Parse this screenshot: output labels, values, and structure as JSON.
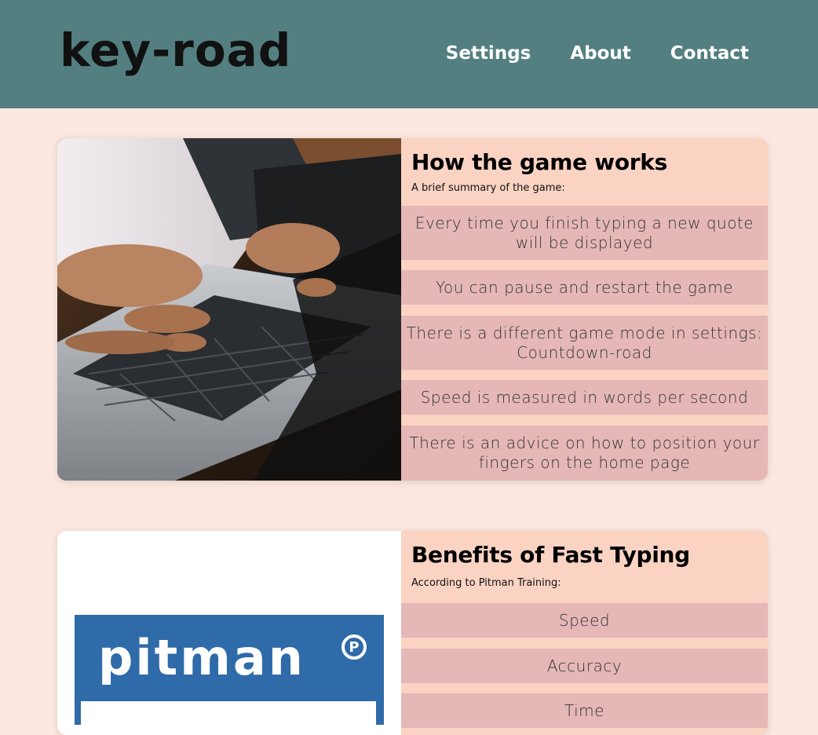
{
  "header": {
    "logo": "key-road",
    "nav": [
      "Settings",
      "About",
      "Contact"
    ]
  },
  "card1": {
    "image": "laptop-typing-photo",
    "title": "How the game works",
    "subtitle": "A brief summary of the game:",
    "items": [
      "Every time you finish typing a new quote will be displayed",
      "You can pause and restart the game",
      "There is a different game mode in settings: Countdown-road",
      "Speed is measured in words per second",
      "There is an advice on how to position your fingers on the home page"
    ]
  },
  "card2": {
    "logo_text": "pitman",
    "logo_mark": "P",
    "title": "Benefits of Fast Typing",
    "subtitle": "According to Pitman Training:",
    "items": [
      "Speed",
      "Accuracy",
      "Time"
    ]
  },
  "colors": {
    "header": "#537f80",
    "page_bg": "#fce8e0",
    "card_bg": "#fad3c3",
    "item_bg": "#e6b7b7",
    "pitman_blue": "#2f6aa9"
  }
}
